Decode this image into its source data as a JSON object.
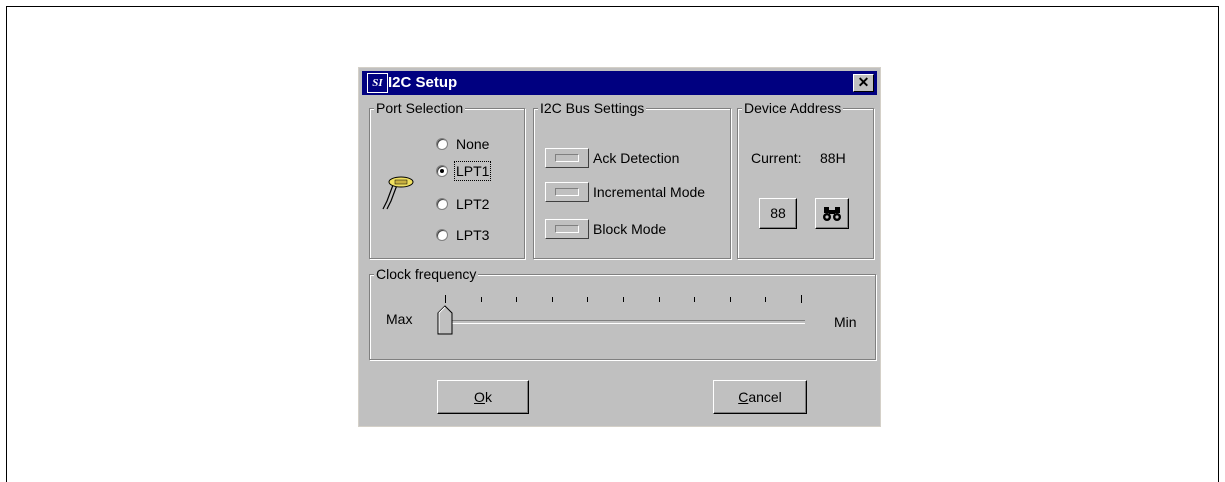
{
  "dialog": {
    "icon_text": "SI",
    "title": "I2C Setup",
    "close_glyph": "✕"
  },
  "port_selection": {
    "title": "Port Selection",
    "options": [
      {
        "label": "None",
        "checked": false
      },
      {
        "label": "LPT1",
        "checked": true
      },
      {
        "label": "LPT2",
        "checked": false
      },
      {
        "label": "LPT3",
        "checked": false
      }
    ],
    "icon": "parallel-cable-icon"
  },
  "bus_settings": {
    "title": "I2C Bus Settings",
    "toggles": [
      {
        "label": "Ack Detection"
      },
      {
        "label": "Incremental Mode"
      },
      {
        "label": "Block Mode"
      }
    ]
  },
  "device_address": {
    "title": "Device Address",
    "current_label": "Current:",
    "current_value": "88H",
    "address_button": "88",
    "search_icon": "binoculars-icon"
  },
  "clock": {
    "title": "Clock frequency",
    "max_label": "Max",
    "min_label": "Min",
    "tick_count": 11,
    "position": 0
  },
  "buttons": {
    "ok_mnemonic": "O",
    "ok_rest": "k",
    "cancel_mnemonic": "C",
    "cancel_rest": "ancel"
  }
}
